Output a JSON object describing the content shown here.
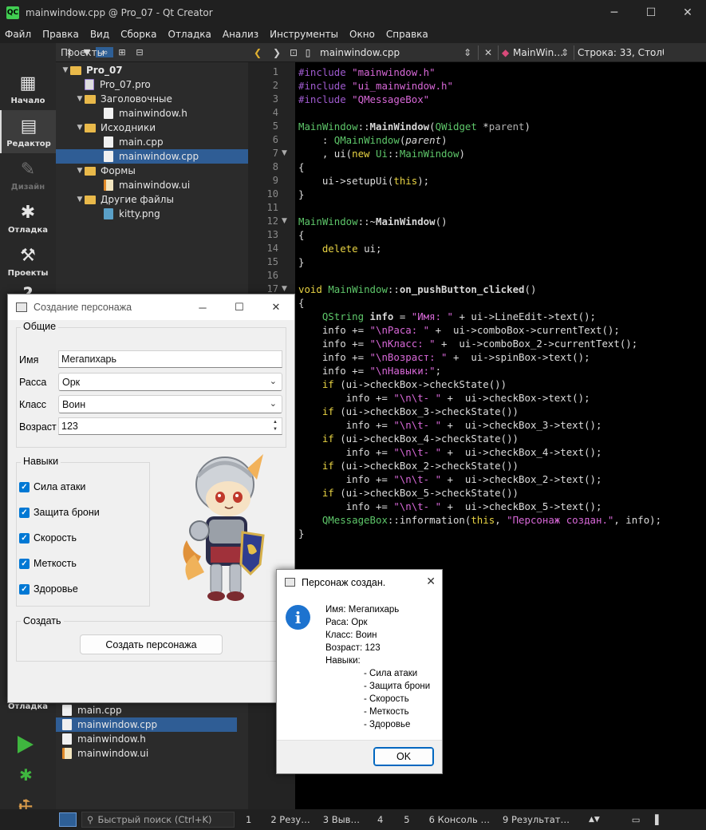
{
  "window": {
    "title": "mainwindow.cpp @ Pro_07 - Qt Creator",
    "minimize": "─",
    "maximize": "☐",
    "close": "✕"
  },
  "menu": [
    "Файл",
    "Правка",
    "Вид",
    "Сборка",
    "Отладка",
    "Анализ",
    "Инструменты",
    "Окно",
    "Справка"
  ],
  "modes": {
    "welcome": "Начало",
    "edit": "Редактор",
    "design": "Дизайн",
    "debug": "Отладка",
    "projects": "Проекты",
    "debug_bottom": "Отладка"
  },
  "projects_panel": {
    "title": "Проекты",
    "tree": [
      {
        "label": "Pro_07",
        "kind": "project"
      },
      {
        "label": "Pro_07.pro",
        "kind": "file-pro"
      },
      {
        "label": "Заголовочные",
        "kind": "folder"
      },
      {
        "label": "mainwindow.h",
        "kind": "file"
      },
      {
        "label": "Исходники",
        "kind": "folder"
      },
      {
        "label": "main.cpp",
        "kind": "file"
      },
      {
        "label": "mainwindow.cpp",
        "kind": "file",
        "selected": true
      },
      {
        "label": "Формы",
        "kind": "folder"
      },
      {
        "label": "mainwindow.ui",
        "kind": "file-ui"
      },
      {
        "label": "Другие файлы",
        "kind": "folder"
      },
      {
        "label": "kitty.png",
        "kind": "file-img"
      }
    ]
  },
  "open_docs": [
    {
      "label": "main.cpp"
    },
    {
      "label": "mainwindow.cpp",
      "selected": true
    },
    {
      "label": "mainwindow.h"
    },
    {
      "label": "mainwindow.ui"
    }
  ],
  "editor_toolbar": {
    "file": "mainwindow.cpp",
    "symbol": "MainWin…",
    "position": "Строка: 33, Столбе"
  },
  "code": {
    "line_numbers": [
      "1",
      "2",
      "3",
      "4",
      "5",
      "6",
      "7",
      "8",
      "9",
      "10",
      "11",
      "12",
      "13",
      "14",
      "15",
      "16",
      "17"
    ]
  },
  "statusbar": {
    "search_placeholder": "Быстрый поиск (Ctrl+K)",
    "panes": [
      "1",
      "2  Резу…",
      "3  Выв…",
      "4",
      "5",
      "6  Консоль …",
      "9  Результат…"
    ]
  },
  "char_dialog": {
    "title": "Создание персонажа",
    "group_general": "Общие",
    "name_label": "Имя",
    "name_value": "Мегапихарь",
    "race_label": "Расса",
    "race_value": "Орк",
    "class_label": "Класс",
    "class_value": "Воин",
    "age_label": "Возраст",
    "age_value": "123",
    "group_skills": "Навыки",
    "skills": [
      {
        "label": "Сила атаки",
        "checked": true
      },
      {
        "label": "Защита брони",
        "checked": true
      },
      {
        "label": "Скорость",
        "checked": true
      },
      {
        "label": "Меткость",
        "checked": true
      },
      {
        "label": "Здоровье",
        "checked": true
      }
    ],
    "group_create": "Создать",
    "create_button": "Создать персонажа"
  },
  "message_box": {
    "title": "Персонаж создан.",
    "lines": [
      "Имя: Мегапихарь",
      "Раса: Орк",
      "Класс: Воин",
      "Возраст: 123",
      "Навыки:"
    ],
    "skill_lines": [
      "- Сила атаки",
      "- Защита брони",
      "- Скорость",
      "- Меткость",
      "- Здоровье"
    ],
    "ok": "OK"
  }
}
